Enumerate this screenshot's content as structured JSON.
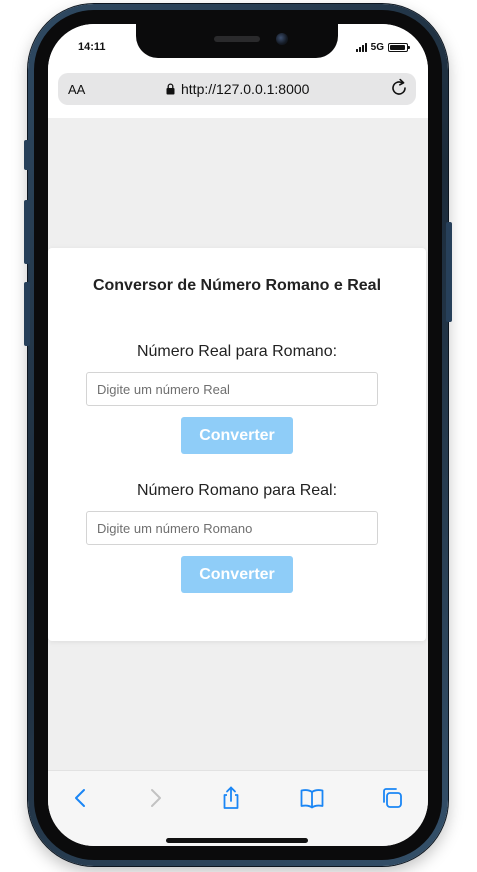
{
  "status_bar": {
    "time": "14:11",
    "network": "5G"
  },
  "browser": {
    "text_size_label": "AA",
    "url": "http://127.0.0.1:8000",
    "icons": [
      "text-size-icon",
      "lock-icon",
      "reload-icon"
    ]
  },
  "converter": {
    "title": "Conversor de Número Romano e Real",
    "real_to_roman": {
      "label": "Número Real para Romano:",
      "placeholder": "Digite um número Real",
      "value": "",
      "button_label": "Converter"
    },
    "roman_to_real": {
      "label": "Número Romano para Real:",
      "placeholder": "Digite um número Romano",
      "value": "",
      "button_label": "Converter"
    }
  },
  "toolbar": {
    "items": [
      "back-icon",
      "forward-icon",
      "share-icon",
      "bookmarks-icon",
      "tabs-icon"
    ]
  },
  "colors": {
    "button": "#8fcdf8",
    "ios_blue": "#1a86f5",
    "page_background": "#efefef",
    "device_frame": "#2f4a63"
  }
}
